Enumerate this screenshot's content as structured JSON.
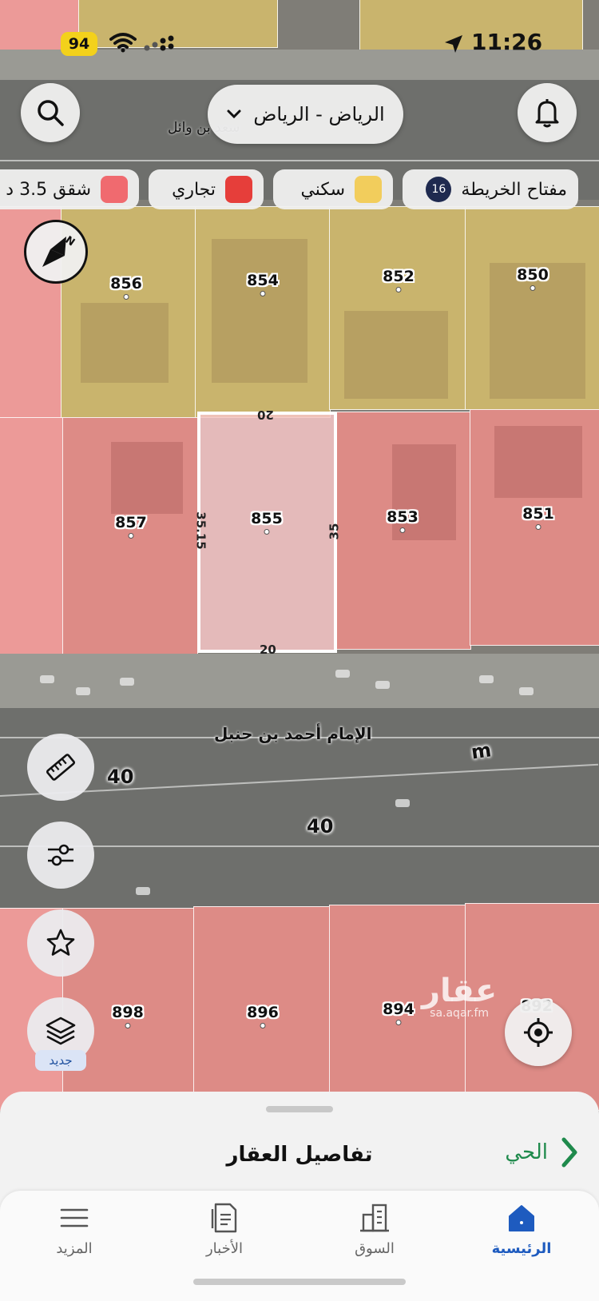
{
  "status_bar": {
    "battery": "94",
    "time": "11:26"
  },
  "header": {
    "city_selector": "الرياض - الرياض",
    "top_street_label": "سعد بن وائل"
  },
  "legend": {
    "map_key_label": "مفتاح الخريطة",
    "map_key_count": "16",
    "items": [
      {
        "label": "سكني",
        "color": "#f2cd5c"
      },
      {
        "label": "تجاري",
        "color": "#e63e3a"
      },
      {
        "label": "شقق 3.5 د",
        "color": "#f06a6f"
      }
    ]
  },
  "map": {
    "parcels_top": [
      "856",
      "854",
      "852",
      "850"
    ],
    "parcels_middle": [
      "857",
      "855",
      "853",
      "851"
    ],
    "parcels_bottom": [
      "898",
      "896",
      "894",
      "892"
    ],
    "selected_parcel": {
      "number": "855",
      "dim_top": "20",
      "dim_bottom": "20",
      "dim_left": "35.15",
      "dim_right": "35"
    },
    "street_name": "الإمام أحمد بن حنبل",
    "street_width_1": "40",
    "street_width_2": "40",
    "scale_marker": "m",
    "watermark_brand": "عقار",
    "watermark_url": "sa.aqar.fm"
  },
  "tools": {
    "new_badge": "جديد"
  },
  "sheet": {
    "title": "تفاصيل العقار",
    "district_link": "الحي"
  },
  "tabs": [
    {
      "label": "الرئيسية",
      "icon": "home-icon",
      "active": true
    },
    {
      "label": "السوق",
      "icon": "buildings-icon",
      "active": false
    },
    {
      "label": "الأخبار",
      "icon": "news-icon",
      "active": false
    },
    {
      "label": "المزيد",
      "icon": "menu-icon",
      "active": false
    }
  ],
  "colors": {
    "accent": "#1e5bbf",
    "district_green": "#1f8a4c"
  }
}
